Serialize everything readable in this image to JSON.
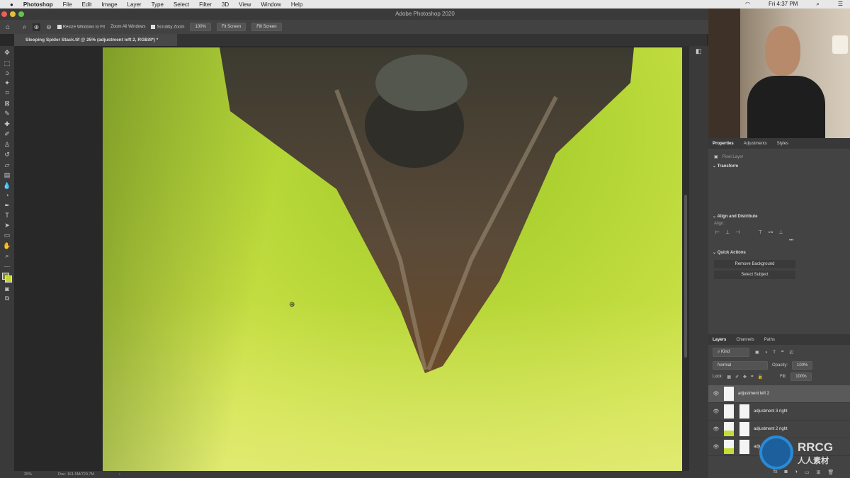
{
  "menubar": {
    "app": "Photoshop",
    "items": [
      "File",
      "Edit",
      "Image",
      "Layer",
      "Type",
      "Select",
      "Filter",
      "3D",
      "View",
      "Window",
      "Help"
    ],
    "clock": "Fri 4:37 PM"
  },
  "window": {
    "title": "Adobe Photoshop 2020"
  },
  "options": {
    "resize": "Resize Windows to Fit",
    "zoom_all": "Zoom All Windows",
    "scrubby": "Scrubby Zoom",
    "btn_100": "100%",
    "fit_screen": "Fit Screen",
    "fill_screen": "Fill Screen"
  },
  "document": {
    "tab": "Sleeping Spider Stack.tif @ 25% (adjustment left 2, RGB/8*) *"
  },
  "status": {
    "zoom": "25%",
    "doc": "Doc: 161.5M/729.7M"
  },
  "properties": {
    "tabs": [
      "Properties",
      "Adjustments",
      "Styles"
    ],
    "layer_type": "Pixel Layer",
    "transform": "Transform",
    "align": "Align and Distribute",
    "align_label": "Align:",
    "quick_actions": "Quick Actions",
    "remove_bg": "Remove Background",
    "select_subject": "Select Subject"
  },
  "layers": {
    "tabs": [
      "Layers",
      "Channels",
      "Paths"
    ],
    "filter": "Kind",
    "blend": "Normal",
    "opacity_label": "Opacity:",
    "opacity": "100%",
    "lock_label": "Lock:",
    "fill_label": "Fill:",
    "fill": "100%",
    "items": [
      {
        "name": "adjustment left 2",
        "selected": true
      },
      {
        "name": "adjustment 3 right"
      },
      {
        "name": "adjustment 2 right"
      },
      {
        "name": "adjust"
      }
    ]
  },
  "watermark": {
    "text": "RRCG",
    "sub": "人人素材"
  }
}
